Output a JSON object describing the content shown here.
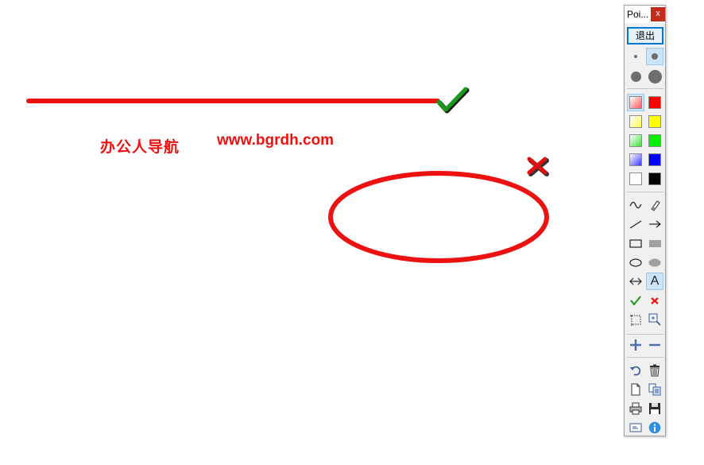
{
  "window": {
    "title": "Poi...",
    "close_label": "x"
  },
  "toolbar": {
    "exit_label": "退出",
    "text_tool_label": "A",
    "pen_sizes": [
      "small",
      "medium",
      "large",
      "x-large"
    ],
    "selected_pen_size": "medium",
    "colors": [
      "#ff0000",
      "#ffff00",
      "#00ff00",
      "#0000ff",
      "#000000"
    ],
    "selected_color": "#ff0000",
    "tools": [
      "freehand",
      "eraser",
      "line",
      "arrow",
      "rectangle",
      "filled-rectangle",
      "ellipse",
      "filled-ellipse",
      "double-arrow",
      "text",
      "checkmark",
      "cross",
      "crop-select",
      "zoom",
      "zoom-in",
      "zoom-out",
      "undo",
      "delete",
      "new",
      "copy",
      "print",
      "save",
      "screen",
      "info"
    ],
    "selected_tool": "text"
  },
  "canvas": {
    "text_cn": "办公人导航",
    "text_url": "www.bgrdh.com",
    "ink_color": "#ee1111",
    "check_color": "#1a9a1a"
  }
}
